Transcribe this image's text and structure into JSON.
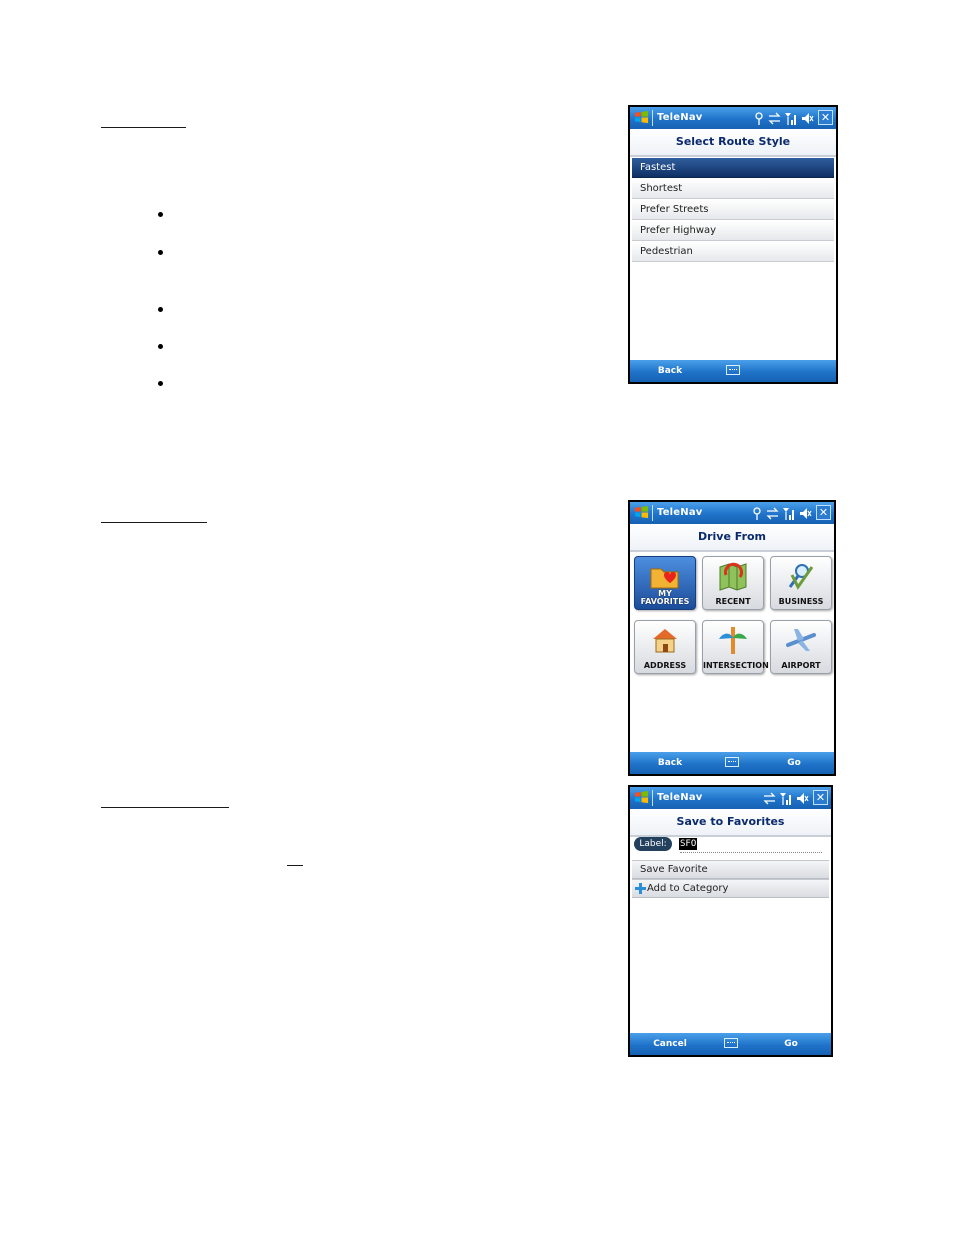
{
  "doc": {
    "bullet_count": 5
  },
  "phones": {
    "route_style": {
      "app_title": "TeleNav",
      "screen_title": "Select Route Style",
      "items": [
        "Fastest",
        "Shortest",
        "Prefer Streets",
        "Prefer Highway",
        "Pedestrian"
      ],
      "selected_index": 0,
      "soft_left": "Back",
      "icons": [
        "antenna-icon",
        "sync-icon",
        "signal-icon",
        "speaker-mute-icon",
        "close-icon"
      ]
    },
    "drive_from": {
      "app_title": "TeleNav",
      "screen_title": "Drive From",
      "tiles": [
        {
          "label_line1": "MY",
          "label_line2": "FAVORITES",
          "icon": "favorites-folder-icon",
          "active": true
        },
        {
          "label_line1": "",
          "label_line2": "RECENT",
          "icon": "recent-map-icon",
          "active": false
        },
        {
          "label_line1": "",
          "label_line2": "BUSINESS",
          "icon": "business-search-icon",
          "active": false
        },
        {
          "label_line1": "",
          "label_line2": "ADDRESS",
          "icon": "house-icon",
          "active": false
        },
        {
          "label_line1": "",
          "label_line2": "INTERSECTION",
          "icon": "intersection-icon",
          "active": false
        },
        {
          "label_line1": "",
          "label_line2": "AIRPORT",
          "icon": "airplane-icon",
          "active": false
        }
      ],
      "soft_left": "Back",
      "soft_right": "Go"
    },
    "save_favorites": {
      "app_title": "TeleNav",
      "screen_title": "Save to Favorites",
      "label_caption": "Label:",
      "label_value": "SFO",
      "save_item": "Save Favorite",
      "add_item": "Add to Category",
      "soft_left": "Cancel",
      "soft_right": "Go"
    }
  },
  "colors": {
    "titlebar_blue": "#1f73c9",
    "selected_navy": "#0f2f63",
    "heading_text": "#0b2a6e"
  }
}
